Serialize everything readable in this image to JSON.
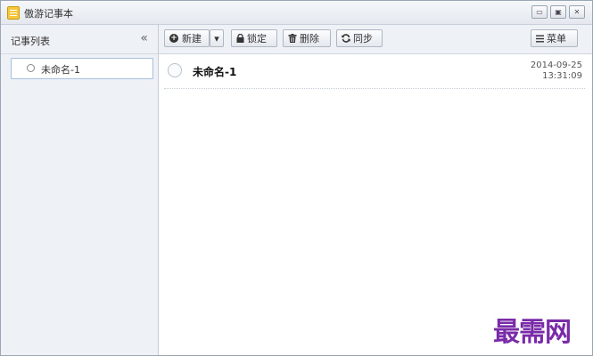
{
  "window": {
    "title": "傲游记事本",
    "controls": {
      "minimize": "▭",
      "maximize": "▣",
      "close": "✕"
    }
  },
  "sidebar": {
    "title": "记事列表",
    "collapse_glyph": "«",
    "items": [
      {
        "label": "未命名-1"
      }
    ]
  },
  "toolbar": {
    "new_label": "新建",
    "dropdown_glyph": "▾",
    "lock_label": "锁定",
    "delete_label": "删除",
    "sync_label": "同步",
    "menu_label": "菜单"
  },
  "note": {
    "title": "未命名-1",
    "date": "2014-09-25",
    "time": "13:31:09"
  },
  "watermark": "最需网"
}
